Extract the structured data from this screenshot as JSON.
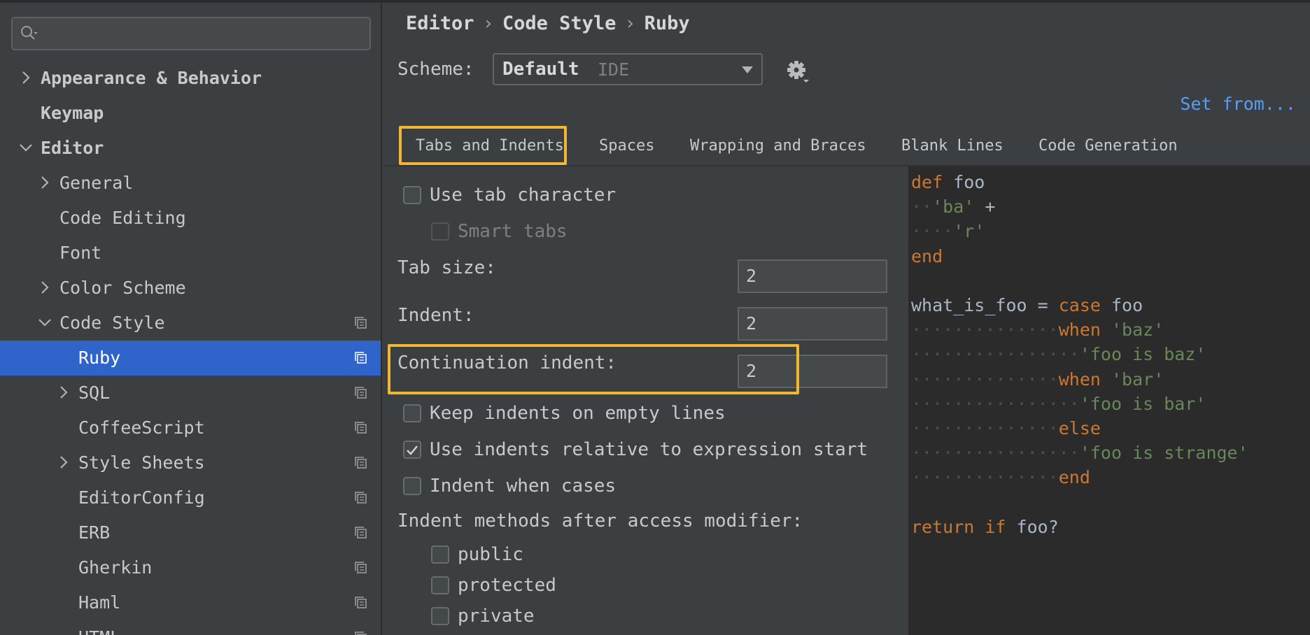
{
  "search": {
    "placeholder": ""
  },
  "tree": [
    {
      "label": "Appearance & Behavior",
      "bold": true,
      "level": 0,
      "chevron": "right"
    },
    {
      "label": "Keymap",
      "bold": true,
      "level": 0,
      "chevron": ""
    },
    {
      "label": "Editor",
      "bold": true,
      "level": 0,
      "chevron": "down"
    },
    {
      "label": "General",
      "level": 1,
      "chevron": "right"
    },
    {
      "label": "Code Editing",
      "level": 1,
      "chevron": ""
    },
    {
      "label": "Font",
      "level": 1,
      "chevron": ""
    },
    {
      "label": "Color Scheme",
      "level": 1,
      "chevron": "right"
    },
    {
      "label": "Code Style",
      "level": 1,
      "chevron": "down",
      "copy": true
    },
    {
      "label": "Ruby",
      "level": 2,
      "chevron": "",
      "copy": true,
      "selected": true
    },
    {
      "label": "SQL",
      "level": 2,
      "chevron": "right",
      "copy": true
    },
    {
      "label": "CoffeeScript",
      "level": 2,
      "chevron": "",
      "copy": true
    },
    {
      "label": "Style Sheets",
      "level": 2,
      "chevron": "right",
      "copy": true
    },
    {
      "label": "EditorConfig",
      "level": 2,
      "chevron": "",
      "copy": true
    },
    {
      "label": "ERB",
      "level": 2,
      "chevron": "",
      "copy": true
    },
    {
      "label": "Gherkin",
      "level": 2,
      "chevron": "",
      "copy": true
    },
    {
      "label": "Haml",
      "level": 2,
      "chevron": "",
      "copy": true
    },
    {
      "label": "HTML",
      "level": 2,
      "chevron": "",
      "copy": true
    }
  ],
  "breadcrumb": {
    "items": [
      "Editor",
      "Code Style",
      "Ruby"
    ],
    "separator": "›"
  },
  "scheme": {
    "label": "Scheme:",
    "value": "Default",
    "scope": "IDE"
  },
  "set_from": "Set from...",
  "tabs": [
    "Tabs and Indents",
    "Spaces",
    "Wrapping and Braces",
    "Blank Lines",
    "Code Generation"
  ],
  "active_tab": "Tabs and Indents",
  "options": {
    "use_tab_character": {
      "label": "Use tab character",
      "checked": false
    },
    "smart_tabs": {
      "label": "Smart tabs",
      "checked": false,
      "disabled": true
    },
    "tab_size": {
      "label": "Tab size:",
      "value": "2"
    },
    "indent": {
      "label": "Indent:",
      "value": "2"
    },
    "continuation_indent": {
      "label": "Continuation indent:",
      "value": "2"
    },
    "keep_indents": {
      "label": "Keep indents on empty lines",
      "checked": false
    },
    "relative_indents": {
      "label": "Use indents relative to expression start",
      "checked": true
    },
    "indent_when_cases": {
      "label": "Indent when cases",
      "checked": false
    },
    "access_modifier_heading": "Indent methods after access modifier:",
    "public": {
      "label": "public",
      "checked": false
    },
    "protected": {
      "label": "protected",
      "checked": false
    },
    "private": {
      "label": "private",
      "checked": false
    }
  },
  "code_preview": [
    [
      [
        "kw",
        "def"
      ],
      [
        "tx",
        " foo"
      ]
    ],
    [
      [
        "ws",
        "··"
      ],
      [
        "st",
        "'ba'"
      ],
      [
        "tx",
        " +"
      ]
    ],
    [
      [
        "ws",
        "····"
      ],
      [
        "st",
        "'r'"
      ]
    ],
    [
      [
        "kw",
        "end"
      ]
    ],
    [],
    [
      [
        "tx",
        "what_is_foo = "
      ],
      [
        "kw",
        "case"
      ],
      [
        "tx",
        " foo"
      ]
    ],
    [
      [
        "ws",
        "··············"
      ],
      [
        "kw",
        "when"
      ],
      [
        "tx",
        " "
      ],
      [
        "st",
        "'baz'"
      ]
    ],
    [
      [
        "ws",
        "················"
      ],
      [
        "st",
        "'foo is baz'"
      ]
    ],
    [
      [
        "ws",
        "··············"
      ],
      [
        "kw",
        "when"
      ],
      [
        "tx",
        " "
      ],
      [
        "st",
        "'bar'"
      ]
    ],
    [
      [
        "ws",
        "················"
      ],
      [
        "st",
        "'foo is bar'"
      ]
    ],
    [
      [
        "ws",
        "··············"
      ],
      [
        "kw",
        "else"
      ]
    ],
    [
      [
        "ws",
        "················"
      ],
      [
        "st",
        "'foo is strange'"
      ]
    ],
    [
      [
        "ws",
        "··············"
      ],
      [
        "kw",
        "end"
      ]
    ],
    [],
    [
      [
        "kw",
        "return"
      ],
      [
        "tx",
        " "
      ],
      [
        "kw",
        "if"
      ],
      [
        "tx",
        " foo?"
      ]
    ]
  ],
  "colors": {
    "selection": "#2f65ca",
    "highlight": "#f1b732",
    "link": "#589df6",
    "keyword": "#cc7832",
    "string": "#6a8759"
  }
}
